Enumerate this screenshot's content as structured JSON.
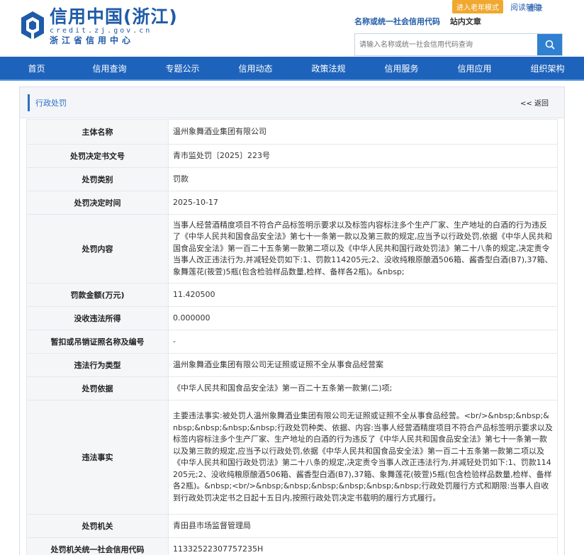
{
  "header": {
    "logo_title": "信用中国(浙江)",
    "logo_domain": "credit.zj.gov.cn",
    "logo_center": "浙江省信用中心",
    "elder_mode": "进入老年模式",
    "help": "阅读辅助",
    "login": "登录",
    "link_unified_code": "名称或统一社会信用代码",
    "link_site_article": "站内文章",
    "search_placeholder": "请输入名称或统一社会信用代码查询"
  },
  "nav": [
    "首页",
    "信用查询",
    "专题公示",
    "信用动态",
    "政策法规",
    "信用服务",
    "信用应用",
    "组织架构"
  ],
  "panel": {
    "title": "行政处罚",
    "back": "<< 返回"
  },
  "rows": [
    {
      "label": "主体名称",
      "value": "温州象舞酒业集团有限公司"
    },
    {
      "label": "处罚决定书文号",
      "value": "青市监处罚〔2025〕223号"
    },
    {
      "label": "处罚类别",
      "value": "罚款"
    },
    {
      "label": "处罚决定时间",
      "value": "2025-10-17"
    },
    {
      "label": "处罚内容",
      "value": "当事人经营酒精度项目不符合产品标签明示要求以及标签内容标注多个生产厂家、生产地址的白酒的行为违反了《中华人民共和国食品安全法》第七十一条第一款以及第三款的规定,应当予以行政处罚,依据《中华人民共和国食品安全法》第一百二十五条第一款第二项以及《中华人民共和国行政处罚法》第二十八条的规定,决定责令当事人改正违法行为,并减轻处罚如下:1、罚款114205元;2、没收纯粮原酿酒506箱、酱香型白酒(B7),37箱、象舞莲花(筱萱)5瓶(包含检验样品数量,检样、备样各2瓶)。&nbsp;"
    },
    {
      "label": "罚款金额(万元)",
      "value": "11.420500"
    },
    {
      "label": "没收违法所得",
      "value": "0.000000"
    },
    {
      "label": "暂扣或吊销证照名称及编号",
      "value": "-"
    },
    {
      "label": "违法行为类型",
      "value": "温州象舞酒业集团有限公司无证照或证照不全从事食品经营案"
    },
    {
      "label": "处罚依据",
      "value": "《中华人民共和国食品安全法》第一百二十五条第一款第(二)项;"
    },
    {
      "label": "违法事实",
      "value": "主要违法事实:被处罚人温州象舞酒业集团有限公司无证照或证照不全从事食品经营。<br/>&nbsp;&nbsp;&nbsp;&nbsp;&nbsp;&nbsp;行政处罚种类、依据、内容:当事人经营酒精度项目不符合产品标签明示要求以及标签内容标注多个生产厂家、生产地址的白酒的行为违反了《中华人民共和国食品安全法》第七十一条第一款以及第三款的规定,应当予以行政处罚,依据《中华人民共和国食品安全法》第一百二十五条第一款第二项以及《中华人民共和国行政处罚法》第二十八条的规定,决定责令当事人改正违法行为,并减轻处罚如下:1、罚款114205元;2、没收纯粮原酿酒506箱、酱香型白酒(B7),37箱、象舞莲花(筱萱)5瓶(包含检验样品数量,检样、备样各2瓶)。&nbsp;<br/>&nbsp;&nbsp;&nbsp;&nbsp;&nbsp;&nbsp;行政处罚履行方式和期限:当事人自收到行政处罚决定书之日起十五日内,按照行政处罚决定书载明的履行方式履行。"
    },
    {
      "label": "处罚机关",
      "value": "青田县市场监督管理局"
    },
    {
      "label": "处罚机关统一社会信用代码",
      "value": "11332522307757235H"
    }
  ],
  "colors": {
    "brand_blue": "#1f5ba8",
    "nav_blue": "#1e63bb",
    "elder_orange": "#f0a830",
    "search_blue": "#2f80d1"
  },
  "icons": {
    "logo": "credit-china-logo-icon",
    "search": "search-icon"
  }
}
